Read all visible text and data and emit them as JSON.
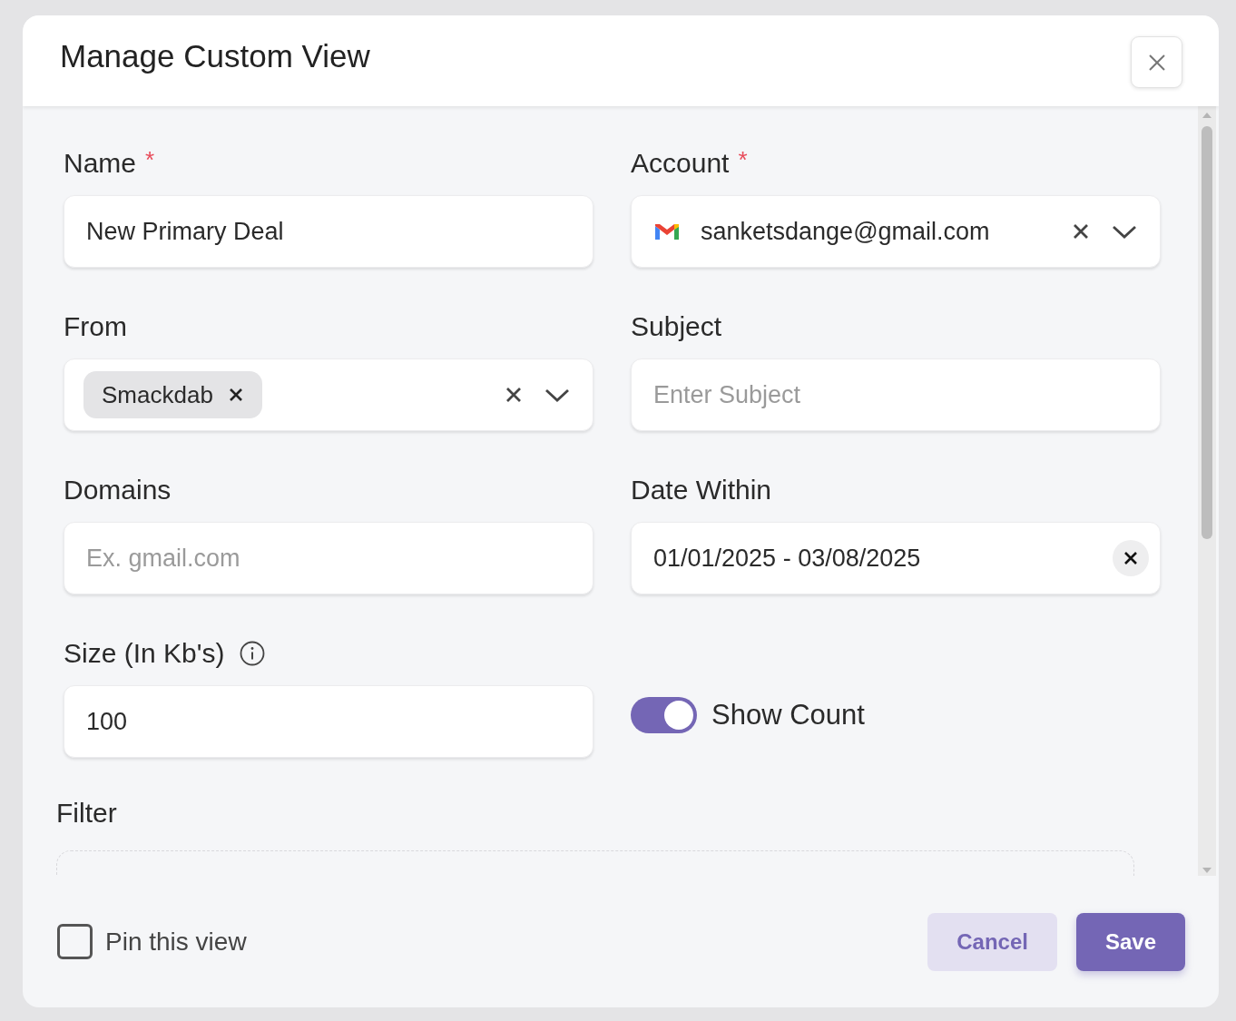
{
  "dialog": {
    "title": "Manage Custom View"
  },
  "fields": [
    {
      "kind": "text",
      "label": "Name",
      "required_mark": "*",
      "value": "New Primary Deal"
    },
    {
      "kind": "account",
      "label": "Account",
      "required_mark": "*",
      "value": "sanketsdange@gmail.com"
    },
    {
      "kind": "tags",
      "label": "From",
      "tags": [
        "Smackdab"
      ]
    },
    {
      "kind": "text",
      "label": "Subject",
      "placeholder": "Enter Subject"
    },
    {
      "kind": "text",
      "label": "Domains",
      "placeholder": "Ex. gmail.com"
    },
    {
      "kind": "date",
      "label": "Date Within",
      "value": "01/01/2025 - 03/08/2025"
    },
    {
      "kind": "text",
      "label": "Size (In Kb's)",
      "value": "100",
      "info": true
    },
    {
      "kind": "toggle",
      "label": "Show Count",
      "on": true
    }
  ],
  "filter": {
    "label": "Filter"
  },
  "pin": {
    "label": "Pin this view",
    "checked": false
  },
  "buttons": [
    {
      "label": "Cancel",
      "kind": "secondary"
    },
    {
      "label": "Save",
      "kind": "primary"
    }
  ]
}
